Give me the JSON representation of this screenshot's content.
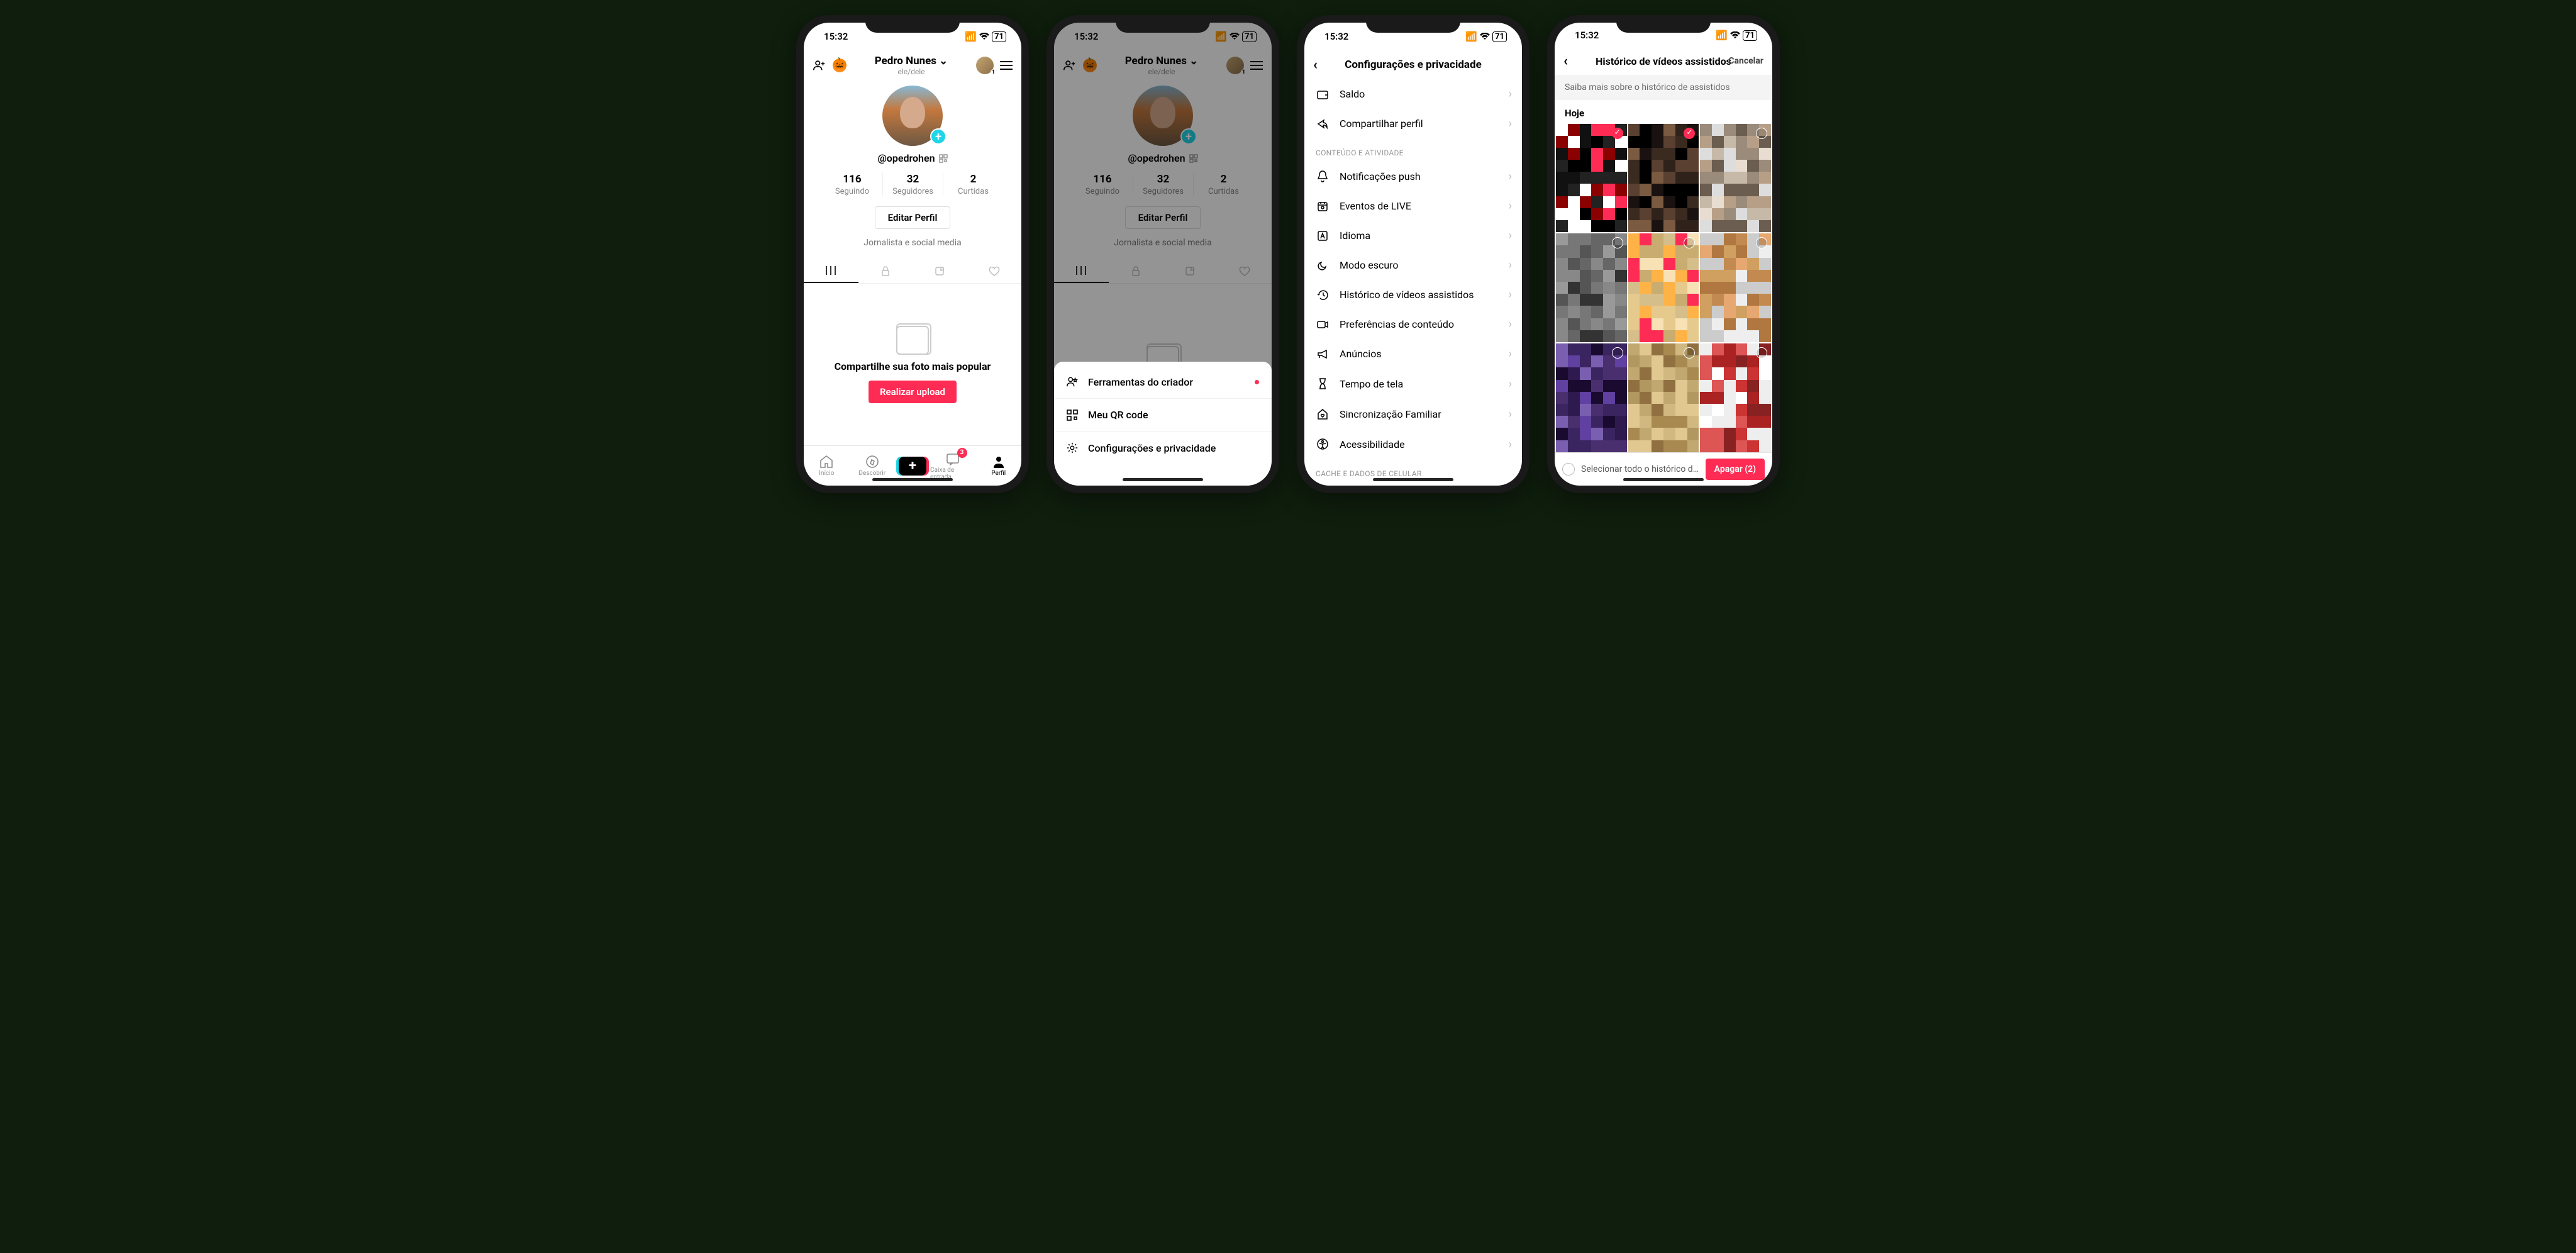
{
  "status": {
    "time": "15:32",
    "battery": "71"
  },
  "profile": {
    "name": "Pedro Nunes",
    "pronoun": "ele/dele",
    "handle": "@opedrohen",
    "stats": {
      "following_n": "116",
      "following_l": "Seguindo",
      "followers_n": "32",
      "followers_l": "Seguidores",
      "likes_n": "2",
      "likes_l": "Curtidas"
    },
    "edit_label": "Editar Perfil",
    "bio": "Jornalista e social media",
    "empty_heading": "Compartilhe sua foto mais popular",
    "upload_label": "Realizar upload"
  },
  "bottom_nav": {
    "home": "Início",
    "discover": "Descobrir",
    "inbox": "Caixa de entrada",
    "inbox_badge": "3",
    "profile": "Perfil"
  },
  "sheet": {
    "creator_tools": "Ferramentas do criador",
    "qr": "Meu QR code",
    "settings": "Configurações e privacidade"
  },
  "settings": {
    "title": "Configurações e privacidade",
    "balance": "Saldo",
    "share": "Compartilhar perfil",
    "section_content": "CONTEÚDO E ATIVIDADE",
    "push": "Notificações push",
    "live": "Eventos de LIVE",
    "language": "Idioma",
    "dark": "Modo escuro",
    "watch_history": "Histórico de vídeos assistidos",
    "content_pref": "Preferências de conteúdo",
    "ads": "Anúncios",
    "screen_time": "Tempo de tela",
    "family": "Sincronização Familiar",
    "accessibility": "Acessibilidade",
    "section_cache": "CACHE E DADOS DE CELULAR"
  },
  "history": {
    "title": "Histórico de vídeos assistidos",
    "cancel": "Cancelar",
    "info": "Saiba mais sobre o histórico de assistidos",
    "today": "Hoje",
    "select_all": "Selecionar todo o histórico de assis...",
    "delete": "Apagar (2)"
  }
}
